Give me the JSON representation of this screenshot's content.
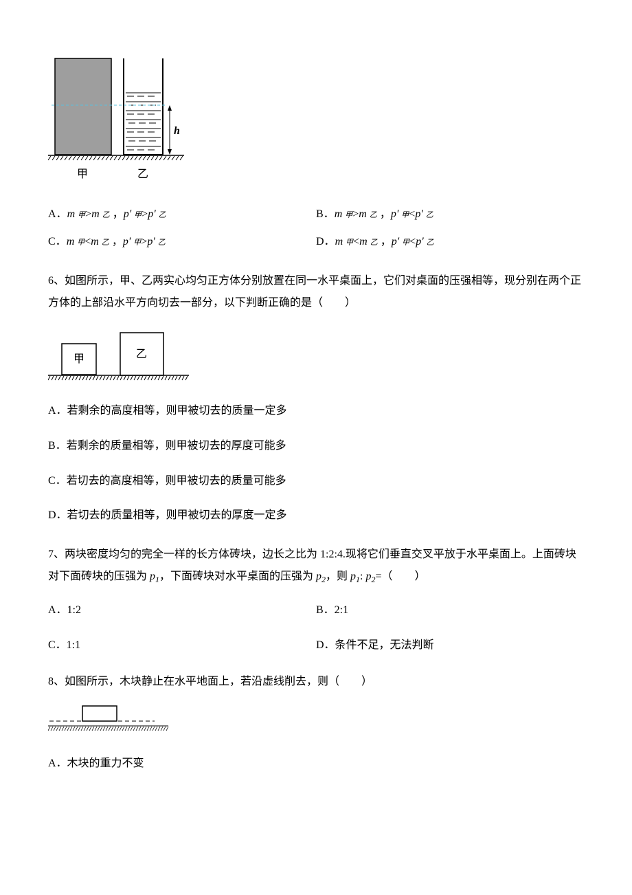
{
  "figure1": {
    "label_left": "甲",
    "label_right": "乙",
    "h_label": "h"
  },
  "q5_options": {
    "a": "A．m 甲>m 乙 ，p' 甲>p' 乙",
    "b": "B．m 甲>m 乙 ，p' 甲<p' 乙",
    "c": "C．m 甲<m 乙 ，p' 甲>p' 乙",
    "d": "D．m 甲<m 乙 ，p' 甲<p' 乙"
  },
  "q6": {
    "text": "6、如图所示，甲、乙两实心均匀正方体分别放置在同一水平桌面上，它们对桌面的压强相等，现分别在两个正方体的上部沿水平方向切去一部分，以下判断正确的是（　　）",
    "figure_left": "甲",
    "figure_right": "乙",
    "a": "A．若剩余的高度相等，则甲被切去的质量一定多",
    "b": "B．若剩余的质量相等，则甲被切去的厚度可能多",
    "c": "C．若切去的高度相等，则甲被切去的质量可能多",
    "d": "D．若切去的质量相等，则甲被切去的厚度一定多"
  },
  "q7": {
    "text_part1": "7、两块密度均匀的完全一样的长方体砖块，边长之比为 1:2:4.现将它们垂直交叉平放于水平桌面上。上面砖块对下面砖块的压强为 ",
    "text_part2": "，下面砖块对水平桌面的压强为 ",
    "text_part3": "，则 ",
    "text_part4": "=（　　）",
    "p1": "p",
    "p1_sub": "1",
    "p2": "p",
    "p2_sub": "2",
    "ratio_p1": "p",
    "ratio_sub1": "1",
    "ratio_colon": ": ",
    "ratio_p2": "p",
    "ratio_sub2": "2",
    "a": "A．1:2",
    "b": "B．2:1",
    "c": "C．1:1",
    "d": "D．条件不足，无法判断"
  },
  "q8": {
    "text": "8、如图所示，木块静止在水平地面上，若沿虚线削去，则（　　）",
    "a": "A．木块的重力不变"
  }
}
